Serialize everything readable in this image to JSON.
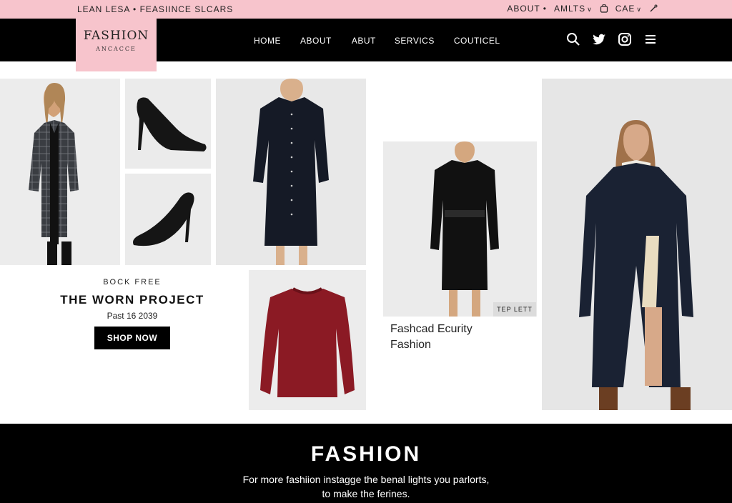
{
  "promo_bar": {
    "left_text": "LEAN LESA • FEASIINCE SLCARS",
    "links": [
      "ABOUT •",
      "AMLTS",
      "CAE"
    ]
  },
  "brand": {
    "name": "FASHION",
    "tagline": "ANCACCE"
  },
  "nav": {
    "items": [
      "HOME",
      "ABOUT",
      "ABUT",
      "SERVICS",
      "COUTICEL"
    ]
  },
  "nav_icons": [
    "search-icon",
    "twitter-icon",
    "instagram-icon",
    "menu-icon"
  ],
  "feature": {
    "eyebrow": "BOCK FREE",
    "title": "THE WORN PROJECT",
    "date": "Past 16 2039",
    "button": "SHOP NOW"
  },
  "product_tag": "TEP LETT",
  "caption": {
    "line1": "Fashcad Ecurity",
    "line2": "Fashion"
  },
  "footer": {
    "title": "FASHION",
    "line1": "For more fashiion instagge the benal lights you parlorts,",
    "line2": "to make the ferines."
  },
  "colors": {
    "accent_pink": "#f7c4cc",
    "black": "#000000",
    "sweater_red": "#8b1a24",
    "navy": "#1a2233"
  }
}
